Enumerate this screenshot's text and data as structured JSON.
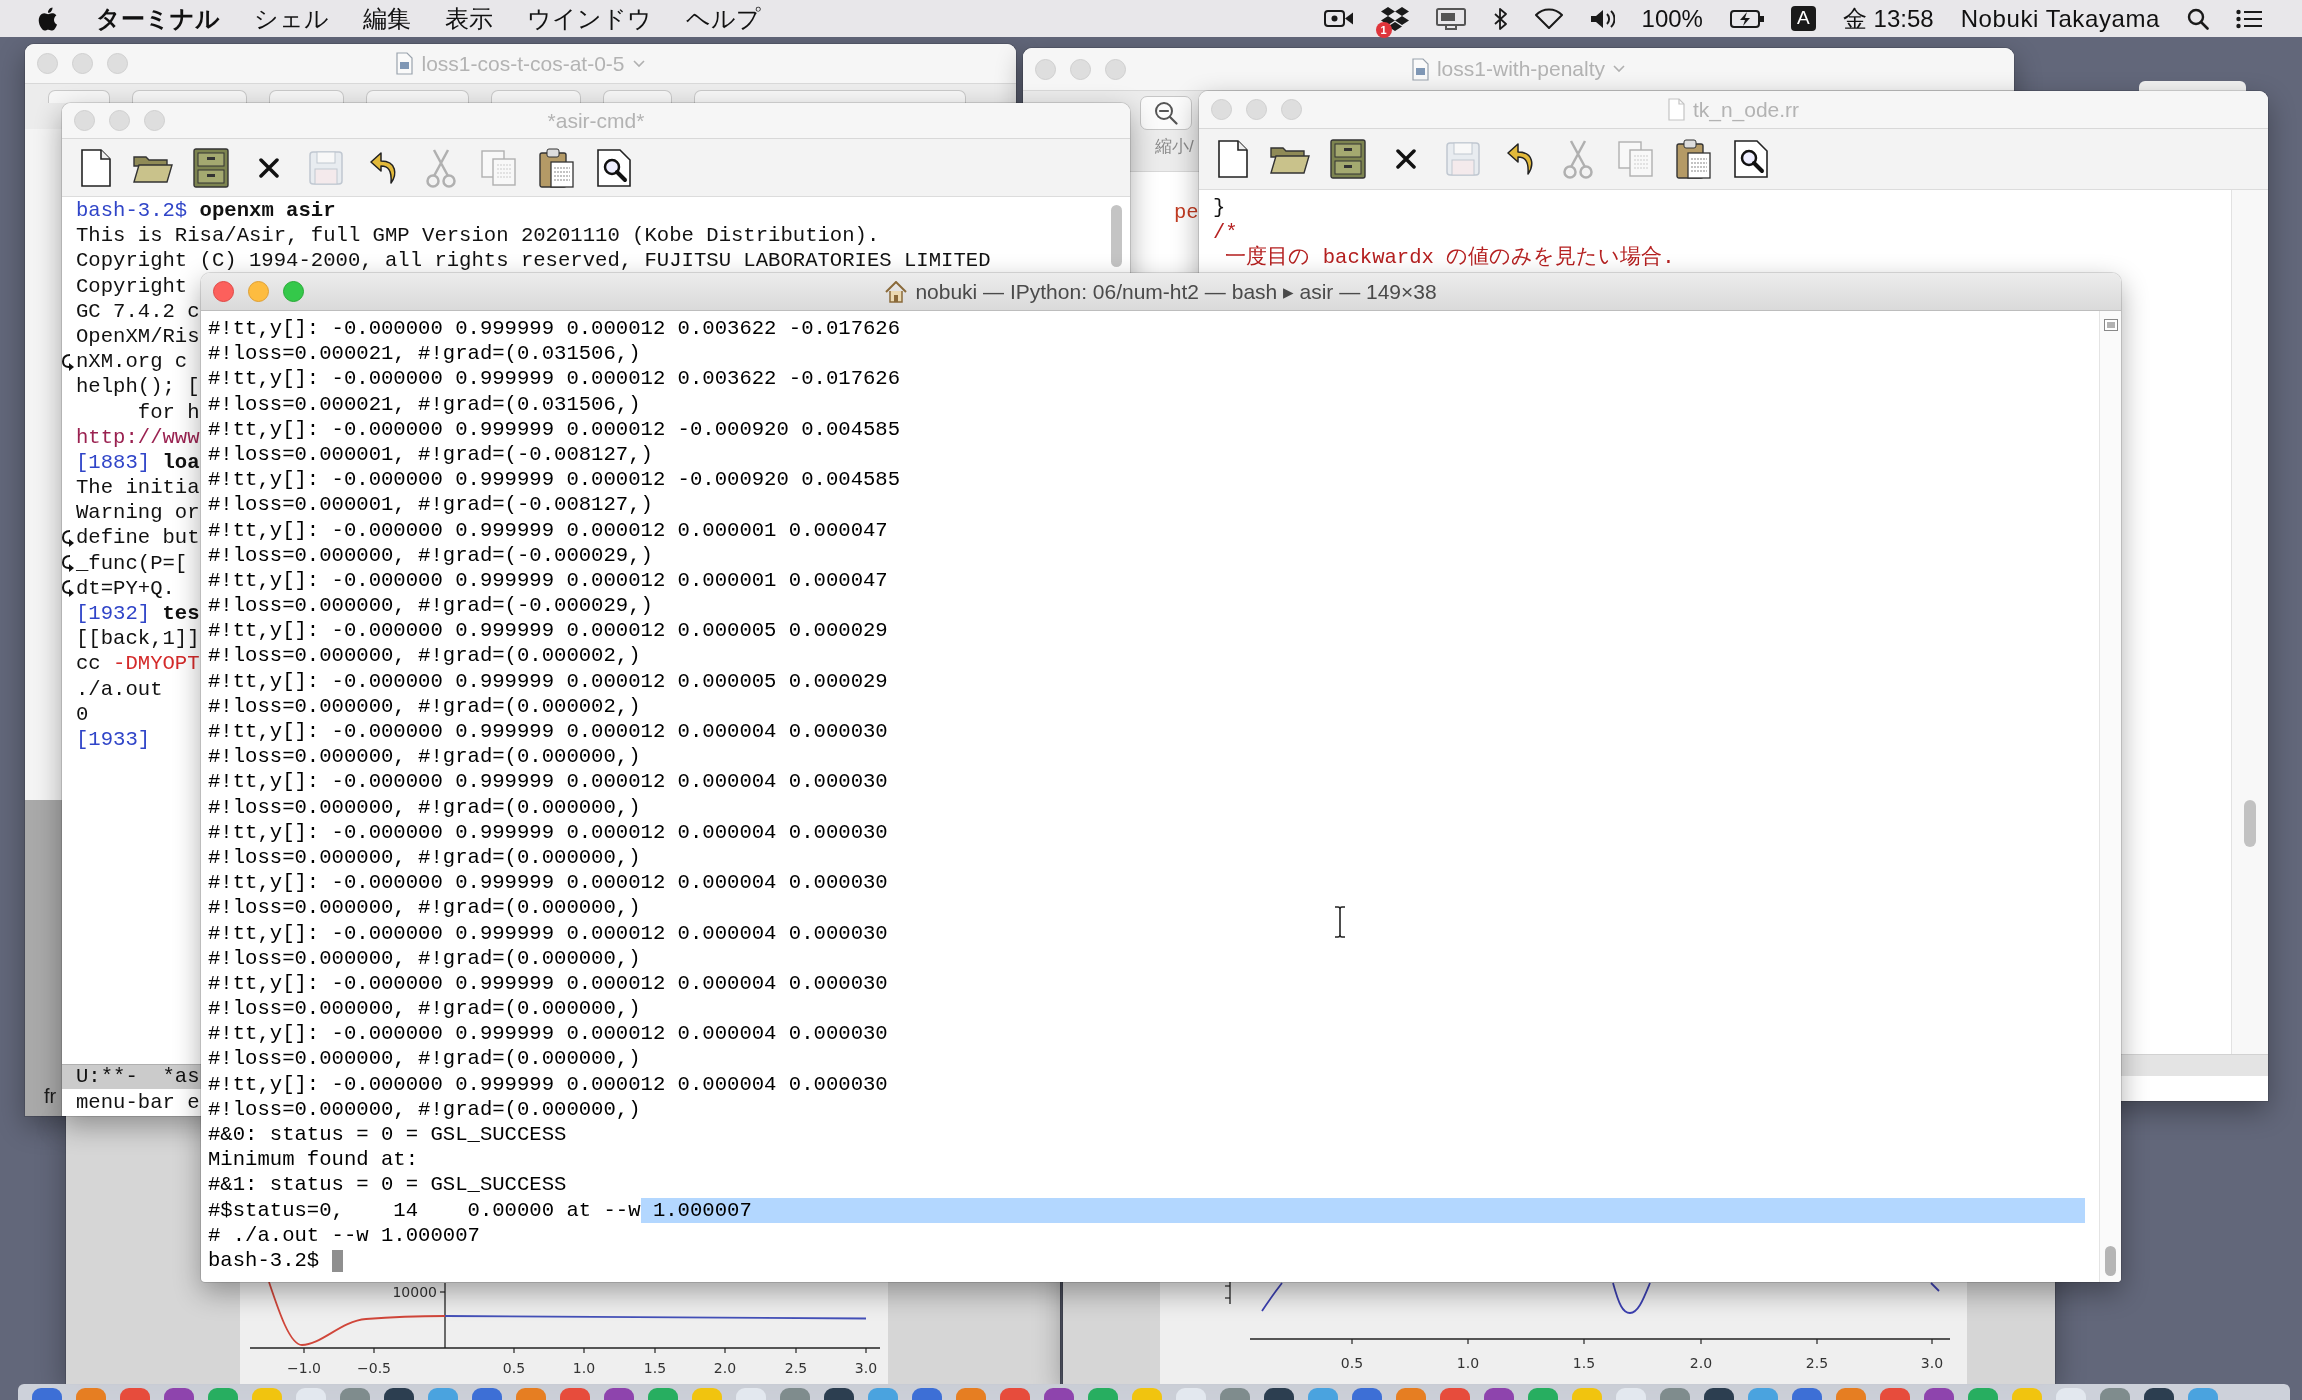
{
  "menu_bar": {
    "app_menu": "ターミナル",
    "menus": [
      "シェル",
      "編集",
      "表示",
      "ウインドウ",
      "ヘルプ"
    ],
    "notification_count": "1",
    "battery_percent": "100%",
    "input_source": "A",
    "clock": "金 13:58",
    "user": "Nobuki Takayama"
  },
  "back_window_left": {
    "title": "loss1-cos-t-cos-at-0-5",
    "active": false,
    "side_text": "fr"
  },
  "back_window_right": {
    "title": "loss1-with-penalty",
    "active": false,
    "toolbar_label": "縮小/",
    "body_text": "pe"
  },
  "asir_window": {
    "title": "*asir-cmd*",
    "active": false,
    "toolbar": [
      {
        "kind": "new",
        "disabled": false
      },
      {
        "kind": "open",
        "disabled": false
      },
      {
        "kind": "dired",
        "disabled": false
      },
      {
        "kind": "kill",
        "disabled": false
      },
      {
        "kind": "save",
        "disabled": true
      },
      {
        "kind": "undo",
        "disabled": false
      },
      {
        "kind": "cut",
        "disabled": true
      },
      {
        "kind": "copy",
        "disabled": true
      },
      {
        "kind": "paste",
        "disabled": false
      },
      {
        "kind": "search",
        "disabled": false
      }
    ],
    "lines": [
      {
        "wrapped": false,
        "segments": [
          {
            "kind": "prompt",
            "text": "bash-3.2$"
          },
          {
            "kind": "input",
            "text": " openxm asir"
          }
        ]
      },
      {
        "wrapped": false,
        "segments": [
          {
            "kind": "plain",
            "text": "This is Risa/Asir, full GMP Version 20201110 (Kobe Distribution)."
          }
        ]
      },
      {
        "wrapped": false,
        "segments": [
          {
            "kind": "plain",
            "text": "Copyright (C) 1994-2000, all rights reserved, FUJITSU LABORATORIES LIMITED"
          }
        ]
      },
      {
        "wrapped": false,
        "segments": [
          {
            "kind": "plain",
            "text": "Copyright"
          }
        ]
      },
      {
        "wrapped": false,
        "segments": [
          {
            "kind": "plain",
            "text": "GC 7.4.2 c"
          }
        ]
      },
      {
        "wrapped": false,
        "segments": [
          {
            "kind": "plain",
            "text": "OpenXM/Ris"
          }
        ]
      },
      {
        "wrapped": true,
        "segments": [
          {
            "kind": "plain",
            "text": "nXM.org c"
          }
        ]
      },
      {
        "wrapped": false,
        "segments": [
          {
            "kind": "plain",
            "text": "helph(); ["
          }
        ]
      },
      {
        "wrapped": false,
        "segments": [
          {
            "kind": "plain",
            "text": "     for h"
          }
        ]
      },
      {
        "wrapped": false,
        "segments": [
          {
            "kind": "link",
            "text": "http://www"
          }
        ]
      },
      {
        "wrapped": false,
        "segments": [
          {
            "kind": "prompt",
            "text": "[1883]"
          },
          {
            "kind": "input",
            "text": " loa"
          }
        ]
      },
      {
        "wrapped": false,
        "segments": [
          {
            "kind": "plain",
            "text": "The initia"
          }
        ]
      },
      {
        "wrapped": false,
        "segments": [
          {
            "kind": "plain",
            "text": "Warning or"
          }
        ]
      },
      {
        "wrapped": true,
        "segments": [
          {
            "kind": "plain",
            "text": "define but"
          }
        ]
      },
      {
        "wrapped": true,
        "segments": [
          {
            "kind": "plain",
            "text": "_func(P=["
          }
        ]
      },
      {
        "wrapped": true,
        "segments": [
          {
            "kind": "plain",
            "text": "dt=PY+Q."
          }
        ]
      },
      {
        "wrapped": false,
        "segments": [
          {
            "kind": "prompt",
            "text": "[1932]"
          },
          {
            "kind": "input",
            "text": " tes"
          }
        ]
      },
      {
        "wrapped": false,
        "segments": [
          {
            "kind": "plain",
            "text": "[[back,1]]"
          }
        ]
      },
      {
        "wrapped": false,
        "segments": [
          {
            "kind": "plain",
            "text": "cc "
          },
          {
            "kind": "flag",
            "text": "-DMYOPT"
          }
        ]
      },
      {
        "wrapped": false,
        "segments": [
          {
            "kind": "plain",
            "text": "./a.out"
          }
        ]
      },
      {
        "wrapped": false,
        "segments": [
          {
            "kind": "plain",
            "text": "0"
          }
        ]
      },
      {
        "wrapped": false,
        "segments": [
          {
            "kind": "prompt",
            "text": "[1933]"
          }
        ]
      }
    ],
    "mode_line": "U:**-  *as",
    "echo_area": "menu-bar e"
  },
  "editor_window": {
    "title": "tk_n_ode.rr",
    "active": false,
    "toolbar": [
      {
        "kind": "new",
        "disabled": false
      },
      {
        "kind": "open",
        "disabled": false
      },
      {
        "kind": "dired",
        "disabled": false
      },
      {
        "kind": "kill",
        "disabled": false
      },
      {
        "kind": "save",
        "disabled": true
      },
      {
        "kind": "undo",
        "disabled": false
      },
      {
        "kind": "cut",
        "disabled": true
      },
      {
        "kind": "copy",
        "disabled": true
      },
      {
        "kind": "paste",
        "disabled": false
      },
      {
        "kind": "search",
        "disabled": false
      }
    ],
    "lines": [
      {
        "segments": [
          {
            "kind": "plain",
            "text": "}"
          }
        ]
      },
      {
        "segments": [
          {
            "kind": "comment",
            "text": "/*"
          }
        ]
      },
      {
        "segments": [
          {
            "kind": "comment",
            "text": " 一度目の backwardx の値のみを見たい場合."
          }
        ]
      }
    ]
  },
  "terminal": {
    "title": "nobuki — IPython: 06/num-ht2 — bash ▸ asir — 149×38",
    "active": true,
    "cursor_visible": true,
    "lines": [
      {
        "text": "#!tt,y[]: -0.000000 0.999999 0.000012 0.003622 -0.017626"
      },
      {
        "text": "#!loss=0.000021, #!grad=(0.031506,)"
      },
      {
        "text": "#!tt,y[]: -0.000000 0.999999 0.000012 0.003622 -0.017626"
      },
      {
        "text": "#!loss=0.000021, #!grad=(0.031506,)"
      },
      {
        "text": "#!tt,y[]: -0.000000 0.999999 0.000012 -0.000920 0.004585"
      },
      {
        "text": "#!loss=0.000001, #!grad=(-0.008127,)"
      },
      {
        "text": "#!tt,y[]: -0.000000 0.999999 0.000012 -0.000920 0.004585"
      },
      {
        "text": "#!loss=0.000001, #!grad=(-0.008127,)"
      },
      {
        "text": "#!tt,y[]: -0.000000 0.999999 0.000012 0.000001 0.000047"
      },
      {
        "text": "#!loss=0.000000, #!grad=(-0.000029,)"
      },
      {
        "text": "#!tt,y[]: -0.000000 0.999999 0.000012 0.000001 0.000047"
      },
      {
        "text": "#!loss=0.000000, #!grad=(-0.000029,)"
      },
      {
        "text": "#!tt,y[]: -0.000000 0.999999 0.000012 0.000005 0.000029"
      },
      {
        "text": "#!loss=0.000000, #!grad=(0.000002,)"
      },
      {
        "text": "#!tt,y[]: -0.000000 0.999999 0.000012 0.000005 0.000029"
      },
      {
        "text": "#!loss=0.000000, #!grad=(0.000002,)"
      },
      {
        "text": "#!tt,y[]: -0.000000 0.999999 0.000012 0.000004 0.000030"
      },
      {
        "text": "#!loss=0.000000, #!grad=(0.000000,)"
      },
      {
        "text": "#!tt,y[]: -0.000000 0.999999 0.000012 0.000004 0.000030"
      },
      {
        "text": "#!loss=0.000000, #!grad=(0.000000,)"
      },
      {
        "text": "#!tt,y[]: -0.000000 0.999999 0.000012 0.000004 0.000030"
      },
      {
        "text": "#!loss=0.000000, #!grad=(0.000000,)"
      },
      {
        "text": "#!tt,y[]: -0.000000 0.999999 0.000012 0.000004 0.000030"
      },
      {
        "text": "#!loss=0.000000, #!grad=(0.000000,)"
      },
      {
        "text": "#!tt,y[]: -0.000000 0.999999 0.000012 0.000004 0.000030"
      },
      {
        "text": "#!loss=0.000000, #!grad=(0.000000,)"
      },
      {
        "text": "#!tt,y[]: -0.000000 0.999999 0.000012 0.000004 0.000030"
      },
      {
        "text": "#!loss=0.000000, #!grad=(0.000000,)"
      },
      {
        "text": "#!tt,y[]: -0.000000 0.999999 0.000012 0.000004 0.000030"
      },
      {
        "text": "#!loss=0.000000, #!grad=(0.000000,)"
      },
      {
        "text": "#!tt,y[]: -0.000000 0.999999 0.000012 0.000004 0.000030"
      },
      {
        "text": "#!loss=0.000000, #!grad=(0.000000,)"
      },
      {
        "text": "#&0: status = 0 = GSL_SUCCESS"
      },
      {
        "text": "Minimum found at:"
      },
      {
        "text": "#&1: status = 0 = GSL_SUCCESS"
      },
      {
        "text": "#$status=0,    14    0.00000 at --w",
        "selected_text": " 1.000007"
      },
      {
        "text": "# ./a.out --w 1.000007"
      },
      {
        "text": "bash-3.2$"
      }
    ]
  },
  "plot_windows": [
    {
      "kind": "decay",
      "y_ticks": [
        "10000"
      ],
      "x_ticks": [
        "−1.0",
        "−0.5",
        "0.5",
        "1.0",
        "1.5",
        "2.0",
        "2.5",
        "3.0"
      ]
    },
    {
      "kind": "wave",
      "x_ticks": [
        "0.5",
        "1.0",
        "1.5",
        "2.0",
        "2.5",
        "3.0"
      ]
    }
  ]
}
